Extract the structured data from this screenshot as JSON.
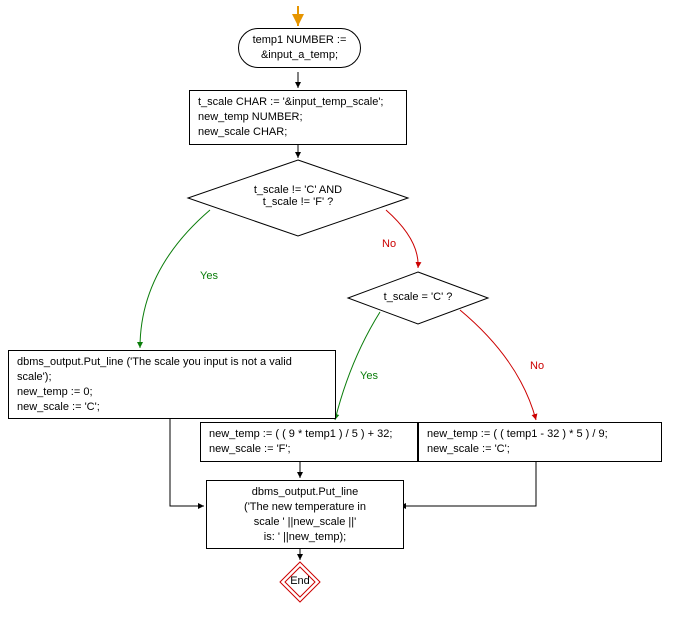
{
  "nodes": {
    "start_decl": "temp1 NUMBER :=\n&input_a_temp;",
    "more_decl": "t_scale CHAR := '&input_temp_scale';\nnew_temp  NUMBER;\nnew_scale CHAR;",
    "cond1": "t_scale != 'C' AND\nt_scale != 'F' ?",
    "cond2": "t_scale = 'C' ?",
    "invalid": "dbms_output.Put_line ('The scale you input is not a valid scale');\nnew_temp := 0;\nnew_scale := 'C';",
    "c_to_f": "new_temp := ( ( 9 * temp1 ) / 5 ) + 32;\nnew_scale := 'F';",
    "f_to_c": "new_temp := ( ( temp1 - 32 ) * 5 ) / 9;\nnew_scale := 'C';",
    "out": "dbms_output.Put_line\n('The new temperature in\nscale ' ||new_scale ||'\nis: ' ||new_temp);",
    "end": "End"
  },
  "edges": {
    "yes1": "Yes",
    "no1": "No",
    "yes2": "Yes",
    "no2": "No"
  }
}
